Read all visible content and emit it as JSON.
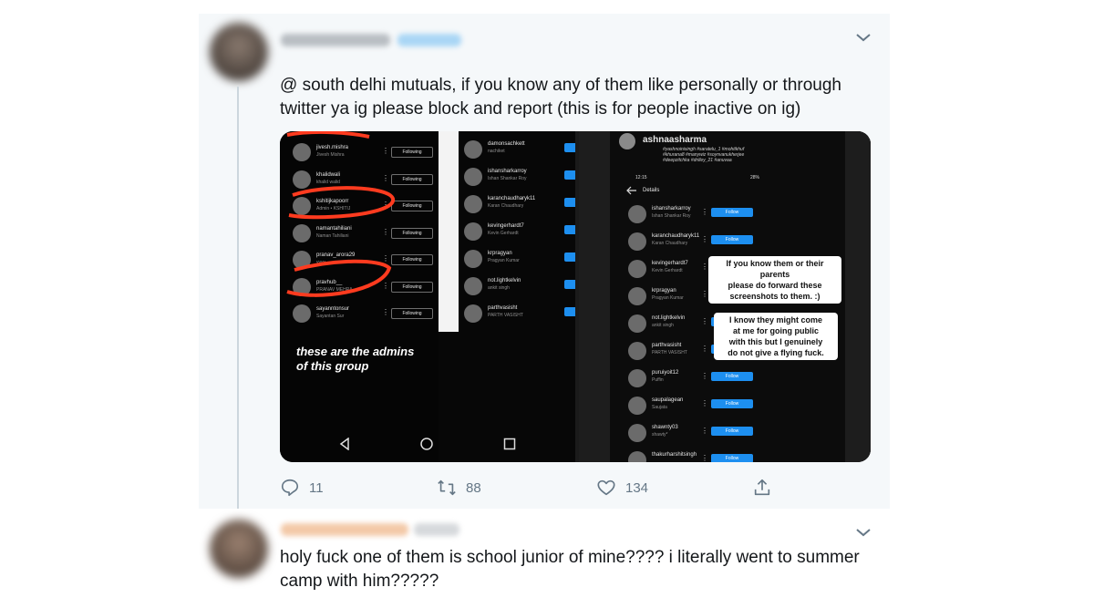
{
  "tweet1": {
    "text": "@ south delhi mutuals, if you know any of them like personally or through twitter ya ig please block and report (this is for people inactive on ig)",
    "actions": {
      "replies": "11",
      "retweets": "88",
      "likes": "134"
    },
    "icons": [
      "reply-icon",
      "retweet-icon",
      "like-icon",
      "share-icon",
      "chevron-down-icon"
    ]
  },
  "media": {
    "left_overlay": "these are the admins\nof this group",
    "left_list": [
      {
        "user": "jivesh.mishra",
        "name": "Jivesh Mishra",
        "btn": "Following"
      },
      {
        "user": "khalidwali",
        "name": "khalid walid",
        "btn": "Following"
      },
      {
        "user": "kshitijkapoorr",
        "name": "Admin • KSHITIJ",
        "btn": "Following"
      },
      {
        "user": "namantahiliani",
        "name": "Naman Tahiliani",
        "btn": "Following"
      },
      {
        "user": "pranav_arora29",
        "name": "yyyy",
        "btn": "Following"
      },
      {
        "user": "pravhub__",
        "name": "PRANAV MEHRA",
        "btn": "Following"
      },
      {
        "user": "sayanntonsur",
        "name": "Sayantan Sur",
        "btn": "Following"
      }
    ],
    "mid_list": [
      {
        "user": "damonsachkett",
        "name": "nachiket"
      },
      {
        "user": "ishansharkarroy",
        "name": "Ishan Shankar Roy"
      },
      {
        "user": "karanchaudharyk11",
        "name": "Karan Chaudhary"
      },
      {
        "user": "kevingerhardt7",
        "name": "Kevin Gerhardt"
      },
      {
        "user": "krpragyan",
        "name": "Pragyan Kumar"
      },
      {
        "user": "not.lightkelvin",
        "name": "ankit singh"
      },
      {
        "user": "parthvasisht",
        "name": "PARTH VASISHT"
      }
    ],
    "right_header": {
      "profile": "ashnaasharma",
      "hashtags": "#yashnoinisingh #saratelu_1 #mohitkhuf\n#khurana8 #manywiz #soynvanukherjee\n#deepzitchka #driiley_21 #anuvaa",
      "status_time": "12:15",
      "status_battery": "28%",
      "details": "Details"
    },
    "right_list": [
      {
        "user": "ishansharkarroy",
        "name": "Ishan Shankar Roy",
        "btn": "Follow"
      },
      {
        "user": "karanchaudharyk11",
        "name": "Karan Chaudhary",
        "btn": "Follow"
      },
      {
        "user": "kevingerhardt7",
        "name": "Kevin Gerhardt",
        "btn": "Follow"
      },
      {
        "user": "krpragyan",
        "name": "Pragyan Kumar",
        "btn": "Follow"
      },
      {
        "user": "not.lightkelvin",
        "name": "ankit singh",
        "btn": "Follow"
      },
      {
        "user": "parthvasisht",
        "name": "PARTH VASISHT",
        "btn": "Follow"
      },
      {
        "user": "puruiyoit12",
        "name": "Puffin",
        "btn": "Follow"
      },
      {
        "user": "saupalagean",
        "name": "Saujata",
        "btn": "Follow"
      },
      {
        "user": "shawnty03",
        "name": "shawty*",
        "btn": "Follow"
      },
      {
        "user": "thakurharshitsingh",
        "name": "",
        "btn": "Follow"
      }
    ],
    "sticker1": "If you know them or their parents\nplease do forward these\nscreenshots to them. :)",
    "sticker2": "I know they might come\nat me for going public\nwith this but I genuinely\ndo not give a flying fuck.",
    "accent": "#1d8ff0",
    "annotation_color": "#ff3b1f"
  },
  "tweet2": {
    "text": "holy fuck one of them is school junior of mine???? i literally went to summer camp with him?????"
  },
  "colors": {
    "bg_tweet": "#f5f8fa",
    "text": "#14171a",
    "muted": "#657786",
    "line": "#ccd6dd"
  }
}
